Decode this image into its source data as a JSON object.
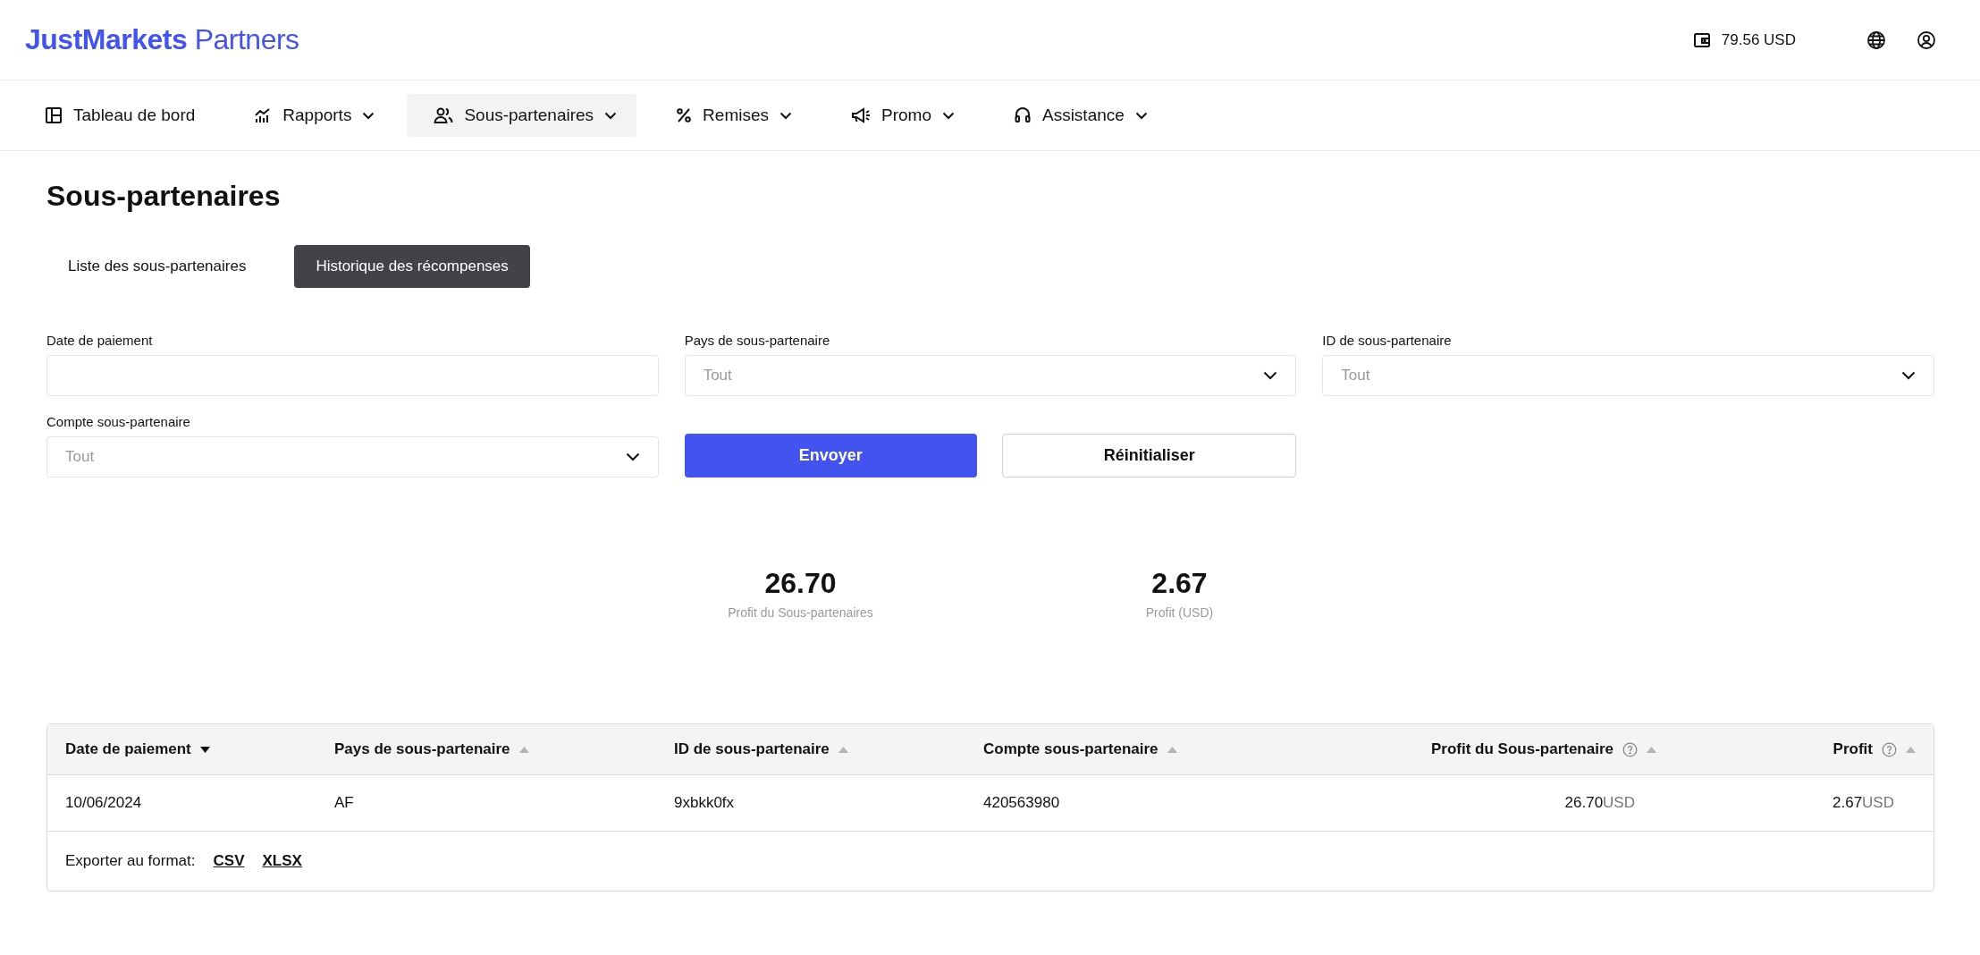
{
  "brand": {
    "name": "JustMarkets",
    "suffix": "Partners"
  },
  "balance": "79.56 USD",
  "nav": [
    {
      "label": "Tableau de bord",
      "kind": "dashboard",
      "has_menu": false,
      "selected": false
    },
    {
      "label": "Rapports",
      "kind": "chart",
      "has_menu": true,
      "selected": false
    },
    {
      "label": "Sous-partenaires",
      "kind": "users",
      "has_menu": true,
      "selected": true
    },
    {
      "label": "Remises",
      "kind": "percent",
      "has_menu": true,
      "selected": false
    },
    {
      "label": "Promo",
      "kind": "megaphone",
      "has_menu": true,
      "selected": false
    },
    {
      "label": "Assistance",
      "kind": "headset",
      "has_menu": true,
      "selected": false
    }
  ],
  "page_title": "Sous-partenaires",
  "tabs": [
    {
      "label": "Liste des sous-partenaires",
      "selected": false
    },
    {
      "label": "Historique des récompenses",
      "selected": true
    }
  ],
  "filters": [
    {
      "label": "Date de paiement",
      "kind": "date"
    },
    {
      "label": "Pays de sous-partenaire",
      "kind": "select",
      "placeholder": "Tout"
    },
    {
      "label": "ID de sous-partenaire",
      "kind": "select",
      "placeholder": "Tout"
    },
    {
      "label": "Compte sous-partenaire",
      "kind": "select",
      "placeholder": "Tout"
    }
  ],
  "buttons": [
    {
      "label": "Envoyer",
      "kind": "primary"
    },
    {
      "label": "Réinitialiser",
      "kind": "secondary"
    }
  ],
  "stats": [
    {
      "value": "26.70",
      "label": "Profit du Sous-partenaires"
    },
    {
      "value": "2.67",
      "label": "Profit (USD)"
    }
  ],
  "table": {
    "columns": [
      {
        "label": "Date de paiement",
        "sorted": true,
        "help": false
      },
      {
        "label": "Pays de sous-partenaire",
        "sorted": false,
        "help": false
      },
      {
        "label": "ID de sous-partenaire",
        "sorted": false,
        "help": false
      },
      {
        "label": "Compte sous-partenaire",
        "sorted": false,
        "help": false
      },
      {
        "label": "Profit du Sous-partenaire",
        "sorted": false,
        "help": true
      },
      {
        "label": "Profit",
        "sorted": false,
        "help": true
      }
    ],
    "rows": [
      {
        "cells": [
          {
            "value": "10/06/2024"
          },
          {
            "value": "AF"
          },
          {
            "value": "9xbkk0fx"
          },
          {
            "value": "420563980"
          },
          {
            "value": "26.70",
            "unit": "USD"
          },
          {
            "value": "2.67",
            "unit": "USD"
          }
        ]
      }
    ]
  },
  "export": {
    "label": "Exporter au format:",
    "links": [
      "CSV",
      "XLSX"
    ]
  }
}
